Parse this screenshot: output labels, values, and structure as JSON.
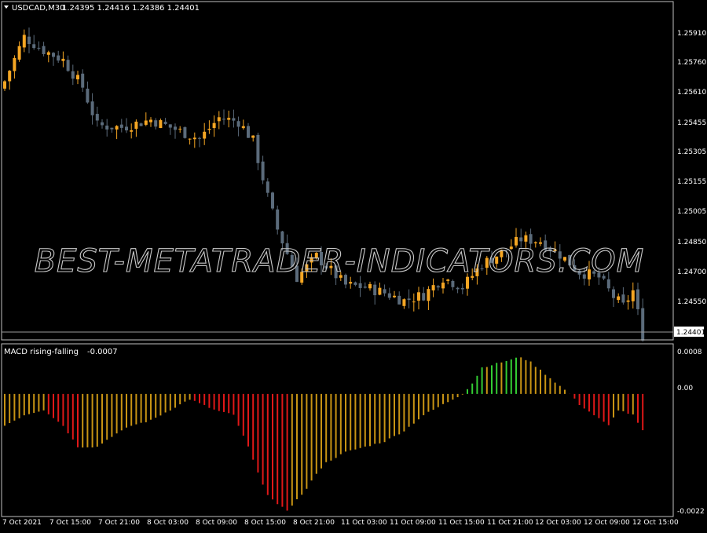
{
  "symbol_header": {
    "symbol": "USDCAD,M30",
    "ohlc": "1.24395 1.24416 1.24386 1.24401"
  },
  "indicator_header": {
    "name": "MACD rising-falling",
    "value": "-0.0007"
  },
  "watermark": "BEST-METATRADER-INDICATORS.COM",
  "colors": {
    "background": "#000000",
    "frame": "#c0c0c0",
    "bull_candle": "#f5a623",
    "bear_candle": "#5b6b7b",
    "hist_neutral": "#c89414",
    "hist_rising": "#33cc33",
    "hist_falling": "#e01818",
    "price_line": "#9a9a9a",
    "current_price_bg": "#ffffff"
  },
  "price_axis": {
    "ticks": [
      "1.25910",
      "1.25760",
      "1.25610",
      "1.25455",
      "1.25305",
      "1.25155",
      "1.25005",
      "1.24850",
      "1.24700",
      "1.24550"
    ],
    "current_price": "1.24401"
  },
  "indicator_axis": {
    "ticks": [
      "0.0008",
      "0.00",
      "-0.0022"
    ]
  },
  "time_axis": {
    "labels": [
      "7 Oct 2021",
      "7 Oct 15:00",
      "7 Oct 21:00",
      "8 Oct 03:00",
      "8 Oct 09:00",
      "8 Oct 15:00",
      "8 Oct 21:00",
      "11 Oct 03:00",
      "11 Oct 09:00",
      "11 Oct 15:00",
      "11 Oct 21:00",
      "12 Oct 03:00",
      "12 Oct 09:00",
      "12 Oct 15:00"
    ]
  },
  "chart_data": [
    {
      "type": "candlestick",
      "title": "USDCAD,M30",
      "ylim": [
        1.2438,
        1.2606
      ],
      "close_path": [
        [
          0,
          1.2572
        ],
        [
          4,
          1.2595
        ],
        [
          8,
          1.2588
        ],
        [
          12,
          1.2583
        ],
        [
          16,
          1.2569
        ],
        [
          19,
          1.2549
        ],
        [
          24,
          1.2548
        ],
        [
          30,
          1.2552
        ],
        [
          36,
          1.2546
        ],
        [
          40,
          1.2542
        ],
        [
          44,
          1.2553
        ],
        [
          48,
          1.2551
        ],
        [
          51,
          1.2541
        ],
        [
          54,
          1.2512
        ],
        [
          56,
          1.2495
        ],
        [
          60,
          1.247
        ],
        [
          64,
          1.2481
        ],
        [
          70,
          1.2466
        ],
        [
          74,
          1.2465
        ],
        [
          78,
          1.2462
        ],
        [
          82,
          1.2458
        ],
        [
          86,
          1.2461
        ],
        [
          90,
          1.247
        ],
        [
          94,
          1.2465
        ],
        [
          98,
          1.2477
        ],
        [
          102,
          1.2483
        ],
        [
          106,
          1.249
        ],
        [
          110,
          1.2489
        ],
        [
          114,
          1.2482
        ],
        [
          118,
          1.2473
        ],
        [
          122,
          1.247
        ],
        [
          125,
          1.246
        ],
        [
          127,
          1.2455
        ],
        [
          129,
          1.2463
        ],
        [
          131,
          1.244
        ]
      ]
    },
    {
      "type": "bar",
      "title": "MACD rising-falling -0.0007",
      "ylim": [
        -0.0022,
        0.0008
      ],
      "key_points": [
        [
          0,
          -0.0006
        ],
        [
          2,
          -0.0005
        ],
        [
          4,
          -0.0004
        ],
        [
          8,
          -0.0003
        ],
        [
          12,
          -0.0006
        ],
        [
          15,
          -0.001
        ],
        [
          19,
          -0.001
        ],
        [
          22,
          -0.0008
        ],
        [
          26,
          -0.0006
        ],
        [
          30,
          -0.0005
        ],
        [
          34,
          -0.0003
        ],
        [
          38,
          -0.0001
        ],
        [
          43,
          -0.0003
        ],
        [
          47,
          -0.0004
        ],
        [
          50,
          -0.001
        ],
        [
          52,
          -0.0015
        ],
        [
          54,
          -0.0019
        ],
        [
          56,
          -0.0021
        ],
        [
          58,
          -0.0022
        ],
        [
          60,
          -0.002
        ],
        [
          62,
          -0.0018
        ],
        [
          64,
          -0.0015
        ],
        [
          66,
          -0.0013
        ],
        [
          70,
          -0.0011
        ],
        [
          74,
          -0.001
        ],
        [
          78,
          -0.0009
        ],
        [
          82,
          -0.0007
        ],
        [
          86,
          -0.0004
        ],
        [
          90,
          -0.0002
        ],
        [
          94,
          0.0
        ],
        [
          96,
          0.0002
        ],
        [
          98,
          0.0005
        ],
        [
          102,
          0.0006
        ],
        [
          106,
          0.0007
        ],
        [
          108,
          0.0006
        ],
        [
          112,
          0.0003
        ],
        [
          116,
          0.0
        ],
        [
          118,
          -0.0002
        ],
        [
          121,
          -0.0004
        ],
        [
          124,
          -0.0006
        ],
        [
          126,
          -0.0003
        ],
        [
          129,
          -0.0004
        ],
        [
          131,
          -0.0007
        ]
      ]
    }
  ]
}
